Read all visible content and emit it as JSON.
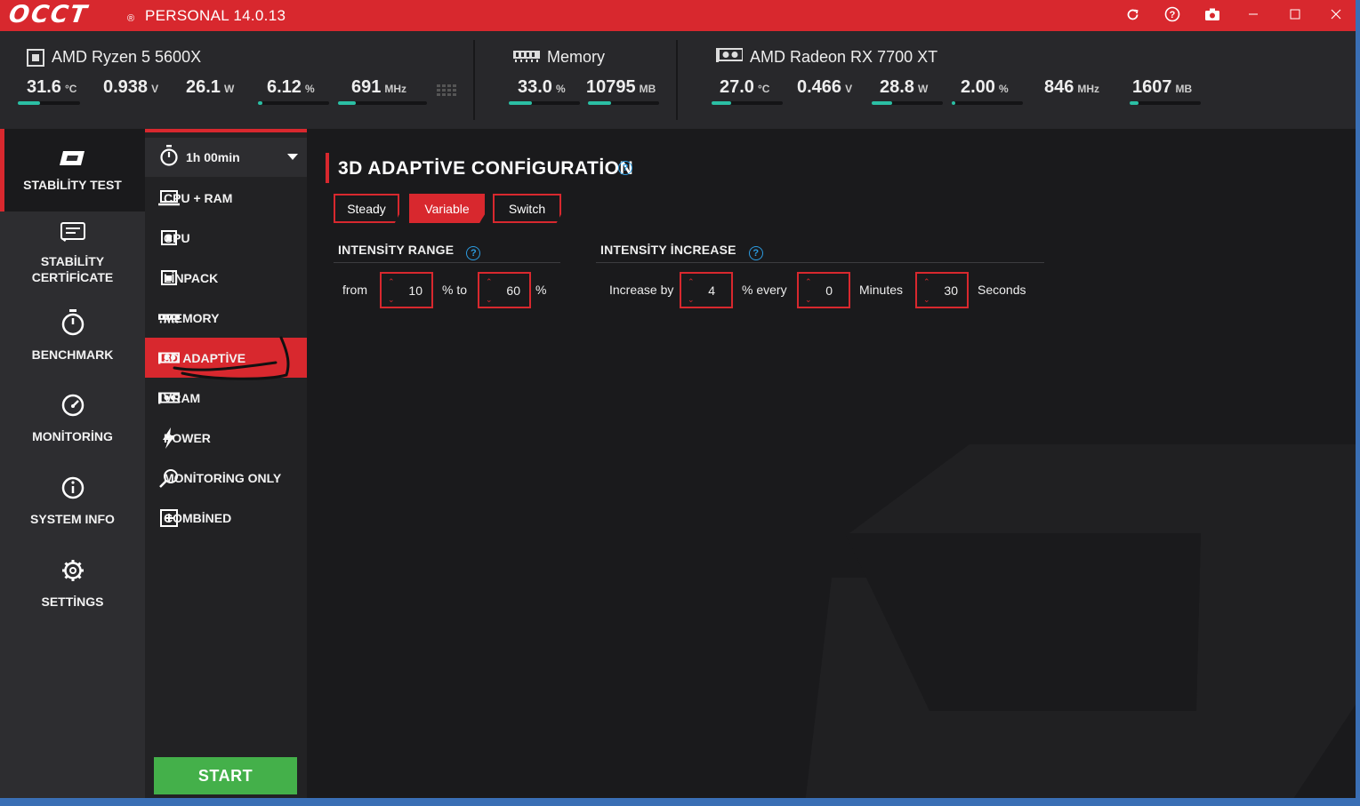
{
  "titlebar": {
    "logo": "OCCT",
    "logo_mark": "®",
    "title": "PERSONAL 14.0.13",
    "icons": [
      "refresh-icon",
      "help-icon",
      "camera-icon",
      "minimize-icon",
      "maximize-icon",
      "close-icon"
    ]
  },
  "hardware": {
    "cpu": {
      "name": "AMD Ryzen 5 5600X",
      "metrics": [
        {
          "value": "31.6",
          "unit": "°C",
          "fill": 0.35
        },
        {
          "value": "0.938",
          "unit": "V",
          "fill": 0
        },
        {
          "value": "26.1",
          "unit": "W",
          "fill": 0
        },
        {
          "value": "6.12",
          "unit": "%",
          "fill": 0.06
        },
        {
          "value": "691",
          "unit": "MHz",
          "fill": 0.2
        }
      ]
    },
    "memory": {
      "name": "Memory",
      "metrics": [
        {
          "value": "33.0",
          "unit": "%",
          "fill": 0.33
        },
        {
          "value": "10795",
          "unit": "MB",
          "fill": 0.33
        }
      ]
    },
    "gpu": {
      "name": "AMD Radeon RX 7700 XT",
      "metrics": [
        {
          "value": "27.0",
          "unit": "°C",
          "fill": 0.27
        },
        {
          "value": "0.466",
          "unit": "V",
          "fill": 0
        },
        {
          "value": "28.8",
          "unit": "W",
          "fill": 0.29
        },
        {
          "value": "2.00",
          "unit": "%",
          "fill": 0.02
        },
        {
          "value": "846",
          "unit": "MHz",
          "fill": 0
        },
        {
          "value": "1607",
          "unit": "MB",
          "fill": 0.13
        }
      ]
    },
    "accent_color": "#2bbfa4"
  },
  "sidebar": {
    "items": [
      {
        "label": "STABİLİTY TEST",
        "icon": "occt-logo-icon",
        "active": true
      },
      {
        "label": "STABİLİTY\nCERTİFİCATE",
        "icon": "certificate-icon",
        "active": false
      },
      {
        "label": "BENCHMARK",
        "icon": "stopwatch-icon",
        "active": false
      },
      {
        "label": "MONİTORİNG",
        "icon": "gauge-icon",
        "active": false
      },
      {
        "label": "SYSTEM INFO",
        "icon": "info-icon",
        "active": false
      },
      {
        "label": "SETTİNGS",
        "icon": "gear-icon",
        "active": false
      }
    ]
  },
  "tests": {
    "duration": "1h 00min",
    "items": [
      {
        "label": "CPU + RAM",
        "icon": "laptop-icon",
        "active": false
      },
      {
        "label": "CPU",
        "icon": "cpu-icon",
        "active": false
      },
      {
        "label": "LİNPACK",
        "icon": "cpu-icon",
        "active": false
      },
      {
        "label": "MEMORY",
        "icon": "memory-icon",
        "active": false
      },
      {
        "label": "3D ADAPTİVE",
        "icon": "gpu-icon",
        "active": true
      },
      {
        "label": "VRAM",
        "icon": "gpu-icon",
        "active": false
      },
      {
        "label": "POWER",
        "icon": "lightning-icon",
        "active": false
      },
      {
        "label": "MONİTORİNG ONLY",
        "icon": "magnifier-icon",
        "active": false
      },
      {
        "label": "COMBİNED",
        "icon": "plus-box-icon",
        "active": false
      }
    ],
    "start_label": "START"
  },
  "config": {
    "title": "3D ADAPTİVE CONFİGURATİON",
    "modes": [
      "Steady",
      "Variable",
      "Switch"
    ],
    "active_mode": "Variable",
    "intensity_range": {
      "title": "INTENSİTY RANGE",
      "from_label": "from",
      "from_value": "10",
      "to_label": "% to",
      "to_value": "60",
      "percent": "%"
    },
    "intensity_increase": {
      "title": "INTENSİTY İNCREASE",
      "increase_label": "Increase by",
      "increase_value": "4",
      "every_label": "% every",
      "minutes_value": "0",
      "minutes_label": "Minutes",
      "seconds_value": "30",
      "seconds_label": "Seconds"
    }
  },
  "colors": {
    "brand_red": "#d8282e",
    "start_green": "#44b04a",
    "help_blue": "#2c9be0"
  }
}
